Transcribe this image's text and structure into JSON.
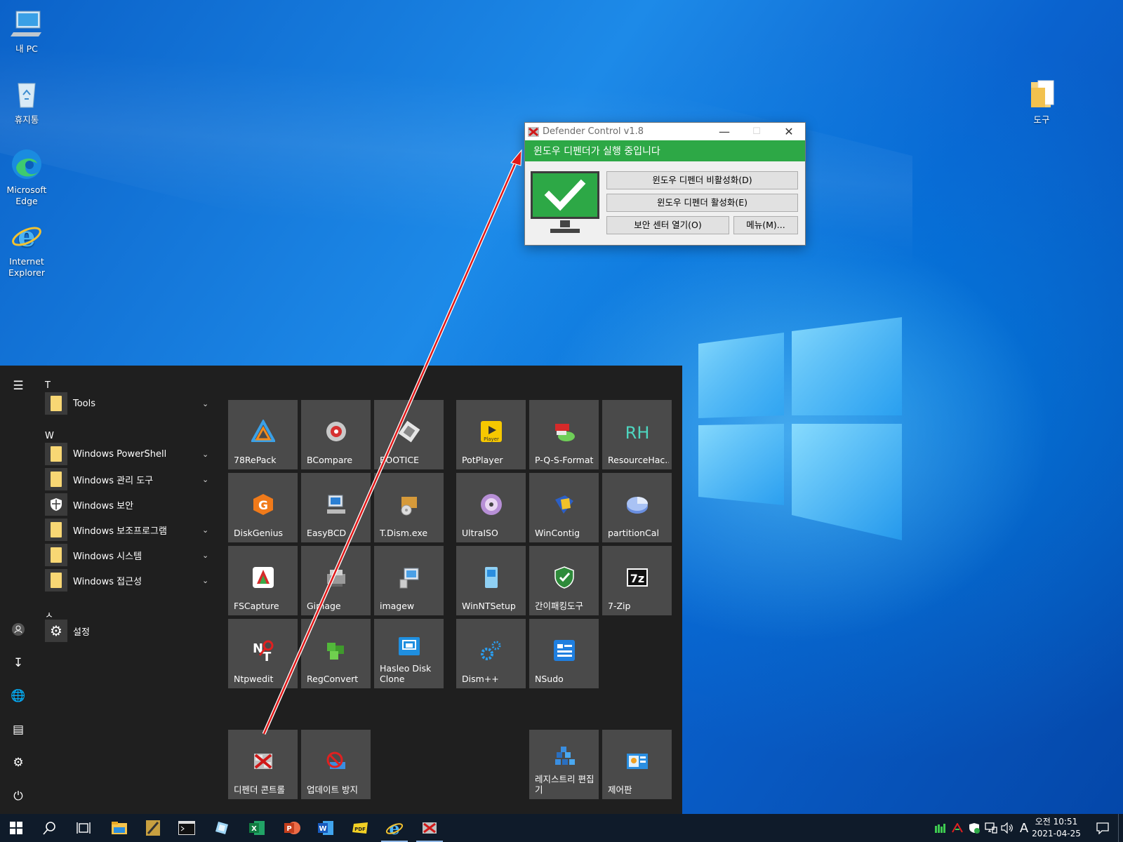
{
  "desktop": {
    "icons": [
      {
        "label": "내 PC",
        "icon": "computer-icon"
      },
      {
        "label": "휴지통",
        "icon": "recycle-bin-icon"
      },
      {
        "label": "Microsoft Edge",
        "icon": "edge-icon"
      },
      {
        "label": "Internet Explorer",
        "icon": "internet-explorer-icon"
      },
      {
        "label": "도구",
        "icon": "folder-icon"
      }
    ]
  },
  "dialog": {
    "title": "Defender Control v1.8",
    "status": "윈도우 디펜더가 실행 중입니다",
    "status_color": "#2da846",
    "buttons": {
      "disable": "윈도우 디펜더 비활성화(D)",
      "enable": "윈도우 디펜더 활성화(E)",
      "security_center": "보안 센터 열기(O)",
      "menu": "메뉴(M)..."
    }
  },
  "start_menu": {
    "groups": [
      {
        "letter": "T",
        "items": [
          {
            "label": "Tools",
            "expandable": true,
            "icon": "folder-icon"
          }
        ]
      },
      {
        "letter": "W",
        "items": [
          {
            "label": "Windows PowerShell",
            "expandable": true,
            "icon": "folder-icon"
          },
          {
            "label": "Windows 관리 도구",
            "expandable": true,
            "icon": "folder-icon"
          },
          {
            "label": "Windows 보안",
            "expandable": false,
            "icon": "shield-icon"
          },
          {
            "label": "Windows 보조프로그램",
            "expandable": true,
            "icon": "folder-icon"
          },
          {
            "label": "Windows 시스템",
            "expandable": true,
            "icon": "folder-icon"
          },
          {
            "label": "Windows 접근성",
            "expandable": true,
            "icon": "folder-icon"
          }
        ]
      },
      {
        "letter": "ㅅ",
        "items": [
          {
            "label": "설정",
            "expandable": false,
            "icon": "gear-icon"
          }
        ]
      }
    ],
    "tiles": [
      {
        "label": "78RePack"
      },
      {
        "label": "BCompare"
      },
      {
        "label": "BOOTICE"
      },
      {
        "label": "PotPlayer"
      },
      {
        "label": "P-Q-S-Format"
      },
      {
        "label": "ResourceHac..."
      },
      {
        "label": "DiskGenius"
      },
      {
        "label": "EasyBCD"
      },
      {
        "label": "T.Dism.exe"
      },
      {
        "label": "UltraISO"
      },
      {
        "label": "WinContig"
      },
      {
        "label": "partitionCal"
      },
      {
        "label": "FSCapture"
      },
      {
        "label": "Gimage"
      },
      {
        "label": "imagew"
      },
      {
        "label": "WinNTSetup"
      },
      {
        "label": "간이패킹도구"
      },
      {
        "label": "7-Zip"
      },
      {
        "label": "Ntpwedit"
      },
      {
        "label": "RegConvert"
      },
      {
        "label": "Hasleo Disk Clone"
      },
      {
        "label": "Dism++"
      },
      {
        "label": "NSudo"
      },
      {
        "label": "디펜더 콘트롤"
      },
      {
        "label": "업데이트 방지"
      },
      {
        "label": "레지스트리 편집기"
      },
      {
        "label": "제어판"
      }
    ],
    "tile_icon_text": {
      "potplayer": "Player",
      "resourcehacker": "RH",
      "sevenzip": "7z"
    }
  },
  "taskbar": {
    "apps": [
      "start-icon",
      "search-icon",
      "task-view-icon",
      "file-explorer-icon",
      "app-icon",
      "cmd-icon",
      "app-icon",
      "excel-icon",
      "powerpoint-icon",
      "word-icon",
      "pdf-icon",
      "internet-explorer-icon",
      "defender-control-icon"
    ],
    "ime": "A",
    "clock_time": "오전 10:51",
    "clock_date": "2021-04-25"
  }
}
